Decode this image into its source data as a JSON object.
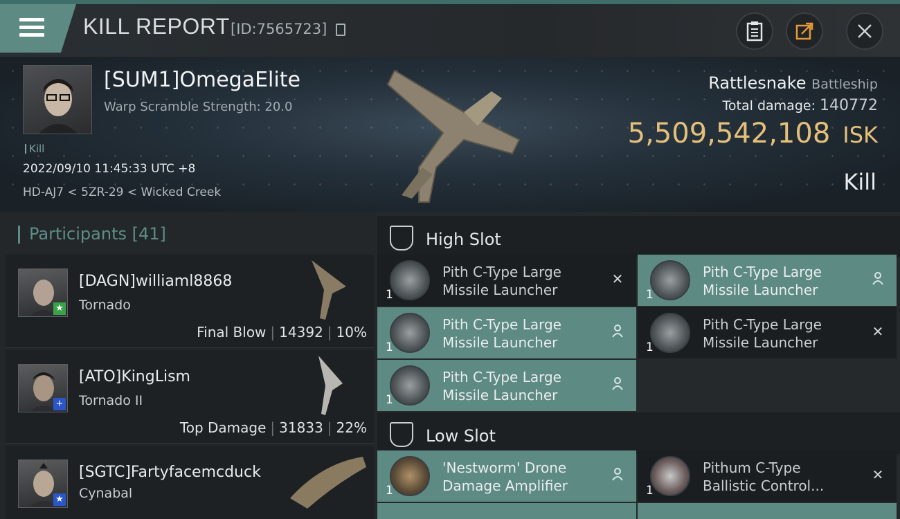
{
  "header": {
    "title": "KILL REPORT",
    "report_id": "[ID:7565723]"
  },
  "victim": {
    "name": "[SUM1]OmegaElite",
    "subtitle": "Warp Scramble Strength: 20.0",
    "tag": "Kill",
    "datetime": "2022/09/10 11:45:33 UTC +8",
    "location": "HD-AJ7 < 5ZR-29 < Wicked Creek",
    "ship": "Rattlesnake",
    "ship_class": "Battleship",
    "damage_label": "Total damage:",
    "damage_value": "140772",
    "isk_value": "5,509,542,108",
    "isk_unit": "ISK",
    "result": "Kill"
  },
  "participants": {
    "label": "Participants",
    "count": "[41]",
    "rows": [
      {
        "name": "[DAGN]williaml8868",
        "ship": "Tornado",
        "stat_label": "Final Blow",
        "damage": "14392",
        "percent": "10%",
        "badge": "★",
        "badge_color": "#3aa34a"
      },
      {
        "name": "[ATO]KingLism",
        "ship": "Tornado II",
        "stat_label": "Top Damage",
        "damage": "31833",
        "percent": "22%",
        "badge": "+",
        "badge_color": "#2a56c8"
      },
      {
        "name": "[SGTC]Fartyfacemcduck",
        "ship": "Cynabal",
        "badge": "★",
        "badge_color": "#2a56c8"
      }
    ]
  },
  "high_slot": {
    "label": "High Slot",
    "items": [
      {
        "line1": "Pith C-Type Large",
        "line2": "Missile Launcher",
        "qty": "1",
        "status": "destroyed"
      },
      {
        "line1": "Pith C-Type Large",
        "line2": "Missile Launcher",
        "qty": "1",
        "status": "dropped"
      },
      {
        "line1": "Pith C-Type Large",
        "line2": "Missile Launcher",
        "qty": "1",
        "status": "dropped"
      },
      {
        "line1": "Pith C-Type Large",
        "line2": "Missile Launcher",
        "qty": "1",
        "status": "destroyed"
      },
      {
        "line1": "Pith C-Type Large",
        "line2": "Missile Launcher",
        "qty": "1",
        "status": "dropped"
      }
    ]
  },
  "low_slot": {
    "label": "Low Slot",
    "items": [
      {
        "line1": "'Nestworm' Drone",
        "line2": "Damage Amplifier",
        "qty": "1",
        "status": "dropped"
      },
      {
        "line1": "Pithum C-Type",
        "line2": "Ballistic Control...",
        "qty": "1",
        "status": "destroyed"
      }
    ]
  },
  "colors": {
    "accent": "#5e8a84",
    "isk": "#e5c07a"
  }
}
